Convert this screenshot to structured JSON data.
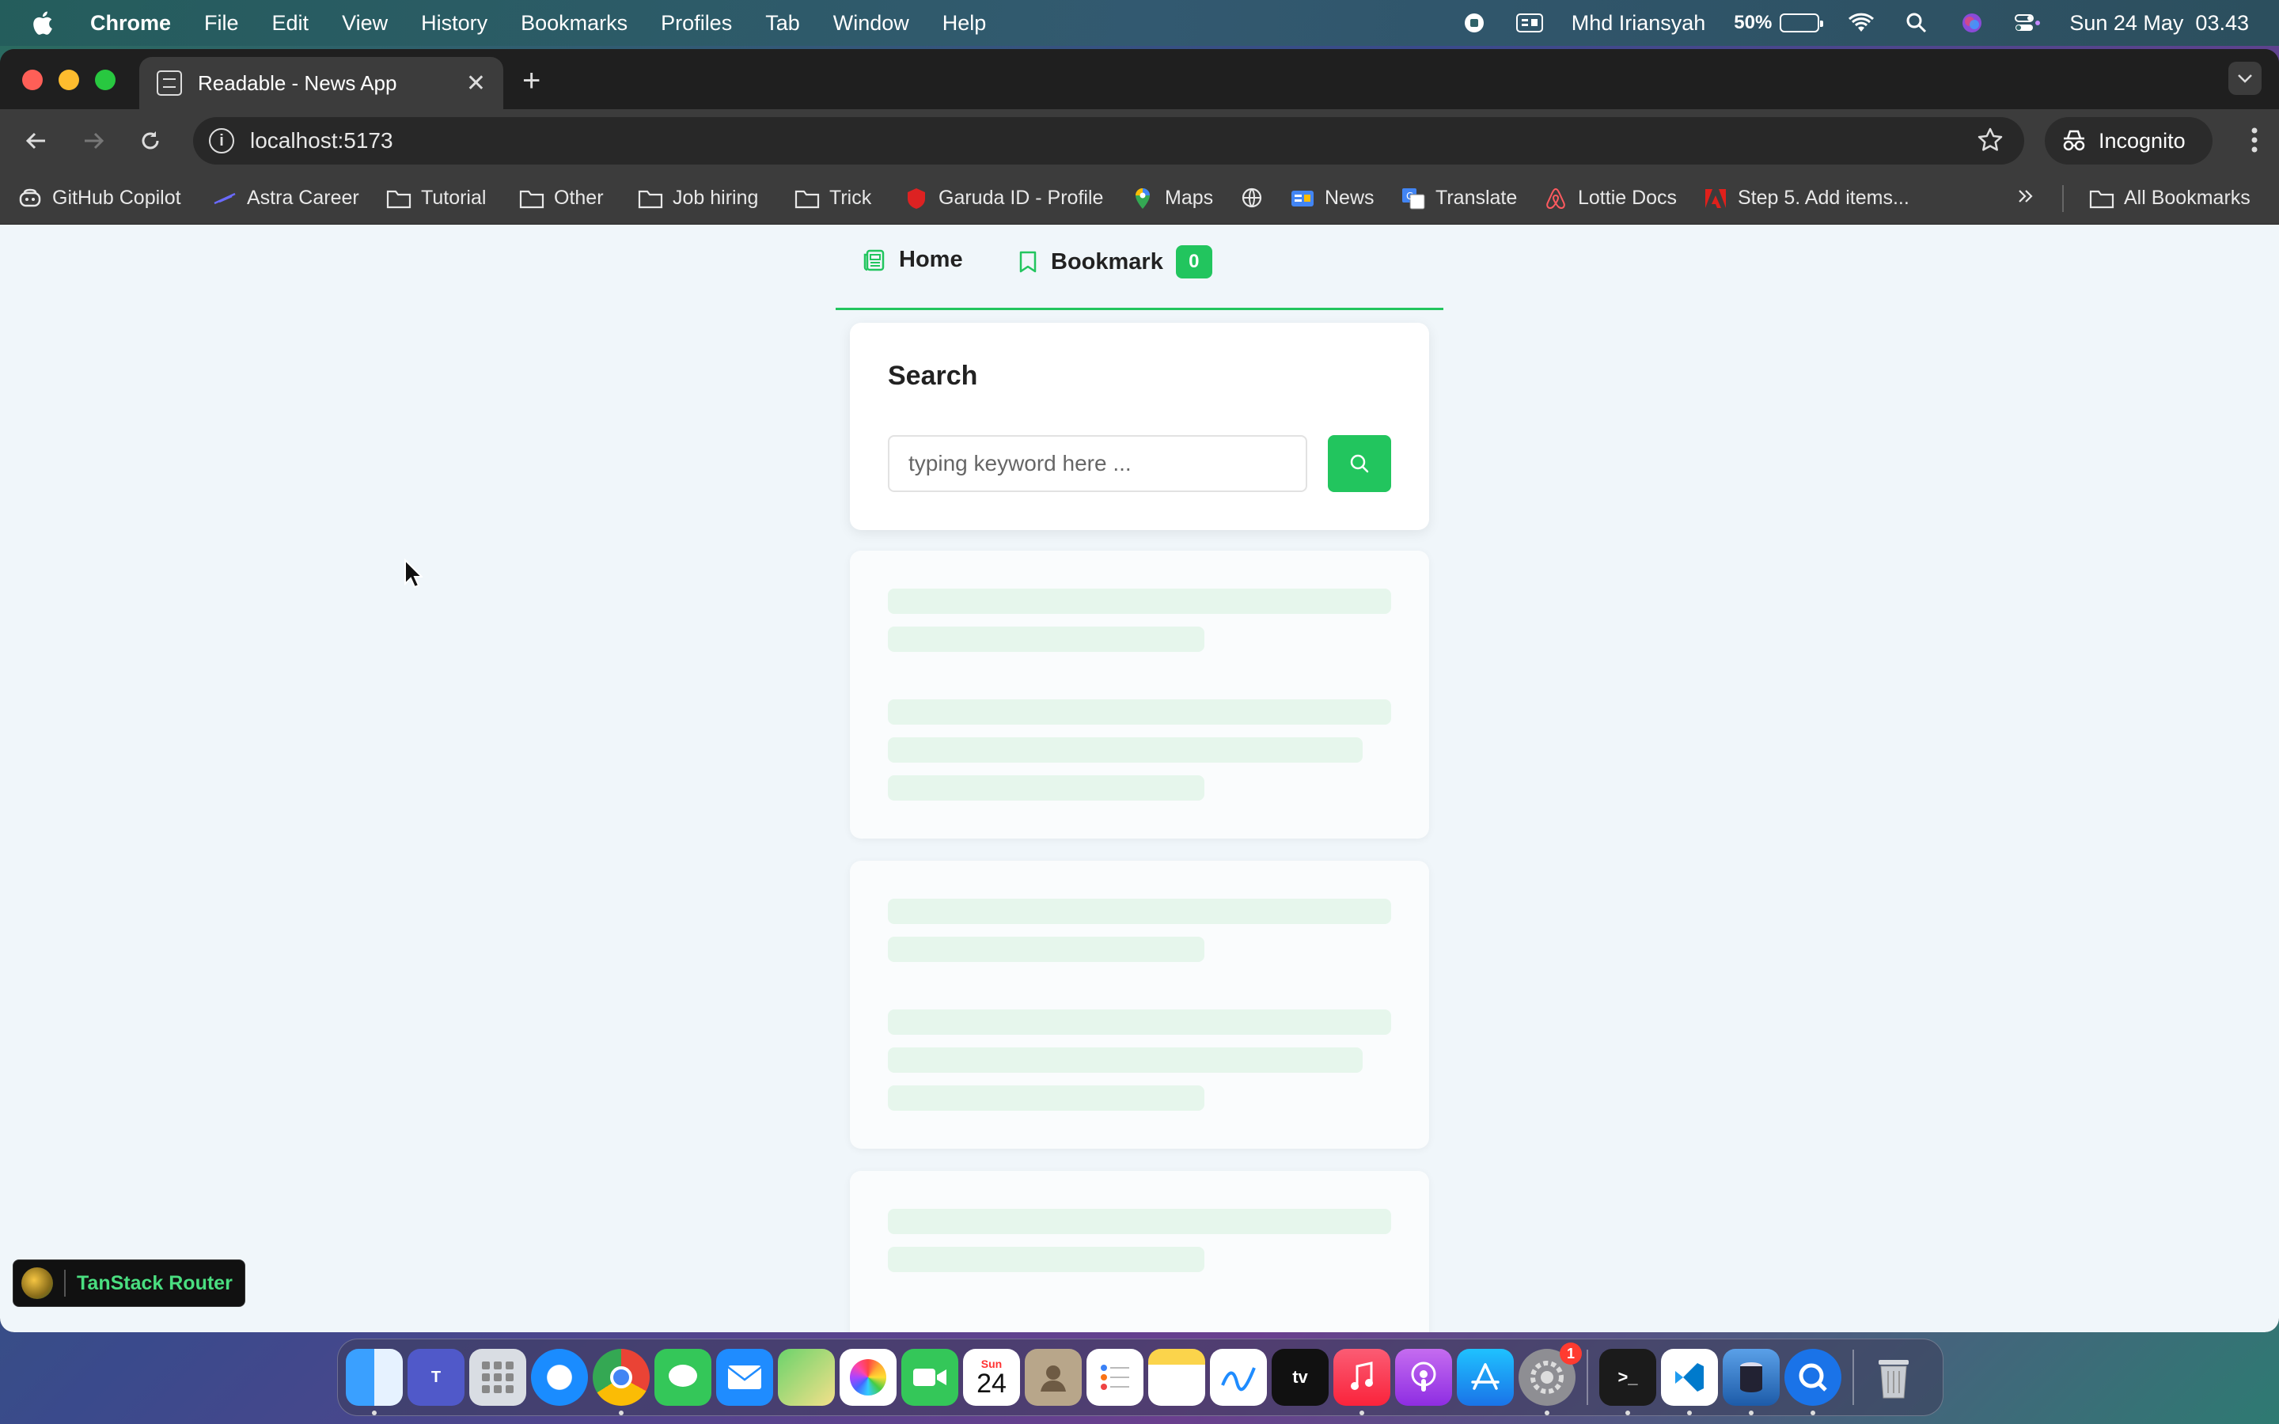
{
  "menubar": {
    "app_name": "Chrome",
    "items": [
      "File",
      "Edit",
      "View",
      "History",
      "Bookmarks",
      "Profiles",
      "Tab",
      "Window",
      "Help"
    ],
    "user": "Mhd Iriansyah",
    "battery_percent": "50%",
    "battery_level": 0.5,
    "datetime": "Sun 24 May  03.43"
  },
  "browser": {
    "tab_title": "Readable - News App",
    "url": "localhost:5173",
    "profile_label": "Incognito",
    "bookmarks": [
      {
        "label": "GitHub Copilot",
        "icon": "copilot-icon"
      },
      {
        "label": "Astra Career",
        "icon": "astra-icon"
      },
      {
        "label": "Tutorial",
        "icon": "folder-icon"
      },
      {
        "label": "Other",
        "icon": "folder-icon"
      },
      {
        "label": "Job hiring",
        "icon": "folder-icon"
      },
      {
        "label": "Trick",
        "icon": "folder-icon"
      },
      {
        "label": "Garuda ID - Profile",
        "icon": "garuda-icon"
      },
      {
        "label": "Maps",
        "icon": "maps-icon"
      },
      {
        "label": "",
        "icon": "globe-icon"
      },
      {
        "label": "News",
        "icon": "google-news-icon"
      },
      {
        "label": "Translate",
        "icon": "translate-icon"
      },
      {
        "label": "Lottie Docs",
        "icon": "airbnb-icon"
      },
      {
        "label": "Step 5. Add items...",
        "icon": "adobe-icon"
      }
    ],
    "all_bookmarks_label": "All Bookmarks"
  },
  "app": {
    "nav": {
      "home_label": "Home",
      "bookmark_label": "Bookmark",
      "bookmark_count": "0"
    },
    "search": {
      "title": "Search",
      "placeholder": "typing keyword here ..."
    },
    "skeleton_cards": 3
  },
  "devtools": {
    "label": "TanStack Router"
  },
  "colors": {
    "accent": "#22c55e",
    "page_bg": "#f0f6fa",
    "skeleton": "#e6f6ec"
  },
  "dock": {
    "apps": [
      "finder",
      "teams",
      "launchpad",
      "safari",
      "chrome",
      "messages",
      "mail",
      "maps",
      "photos",
      "facetime",
      "calendar",
      "contacts",
      "reminders",
      "notes",
      "freeform",
      "apple-tv",
      "music",
      "podcasts",
      "app-store",
      "system-settings",
      "terminal",
      "vscode",
      "sequel",
      "quicktime",
      "trash"
    ],
    "calendar_day": "24",
    "calendar_month": "Sun",
    "settings_badge": "1"
  }
}
